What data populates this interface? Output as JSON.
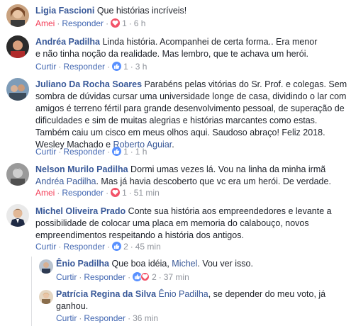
{
  "comments": [
    {
      "author": "Ligia Fascioni",
      "text": " Que histórias incríveis!",
      "action1": "Amei",
      "action2": "Responder",
      "reaction_count": "1",
      "time": "6 h"
    },
    {
      "author": "Andréa Padilha",
      "text": " Linda história. Acompanhei de certa forma.. Era menor e não tinha noção da realidade. Mas lembro, que te achava um herói.",
      "action1": "Curtir",
      "action2": "Responder",
      "reaction_count": "1",
      "time": "3 h"
    },
    {
      "author": "Juliano Da Rocha Soares",
      "text": " Parabéns pelas vitórias do Sr. Prof. e colegas. Sem sombra de dúvidas cursar uma universidade longe de casa, dividindo o lar com amigos é terreno fértil para grande desenvolvimento pessoal, de superação de dificuldades e sim de muitas alegrias e histórias marcantes como estas. Também caiu um cisco em meus olhos aqui. Saudoso abraço! Feliz 2018. Wesley Machado e ",
      "mention": "Roberto Aguiar",
      "text_end": ".",
      "action1": "Curtir",
      "action2": "Responder",
      "reaction_count": "1",
      "time": "1 h"
    },
    {
      "author": "Nelson Murilo Padilha",
      "text": " Dormi umas vezes lá. Vou na linha da minha irmã ",
      "mention": "Andréa Padilha",
      "text_end": ". Mas já havia descoberto que vc era um herói. De verdade.",
      "action1": "Amei",
      "action2": "Responder",
      "reaction_count": "1",
      "time": "51 min"
    },
    {
      "author": "Michel Oliveira Prado",
      "text": " Conte sua história aos empreendedores e levante a possibilidade de colocar uma placa em memoria do calabouço, novos empreendimentos respeitando a história dos antigos.",
      "action1": "Curtir",
      "action2": "Responder",
      "reaction_count": "2",
      "time": "45 min"
    }
  ],
  "replies": [
    {
      "author": "Ênio Padilha",
      "text": " Que boa idéia, ",
      "mention": "Michel",
      "text_end": ". Vou ver isso.",
      "action1": "Curtir",
      "action2": "Responder",
      "reaction_count": "2",
      "time": "37 min"
    },
    {
      "author": "Patrícia Regina da Silva",
      "text": " ",
      "mention": "Ênio Padilha",
      "text_end": ", se depender do meu voto, já ganhou.",
      "action1": "Curtir",
      "action2": "Responder",
      "time": "36 min"
    }
  ],
  "colors": {
    "link": "#385898",
    "action": "#4267b2",
    "love": "#f33e58",
    "meta": "#90949c"
  },
  "icons": [
    "heart-reaction-icon",
    "like-reaction-icon"
  ]
}
